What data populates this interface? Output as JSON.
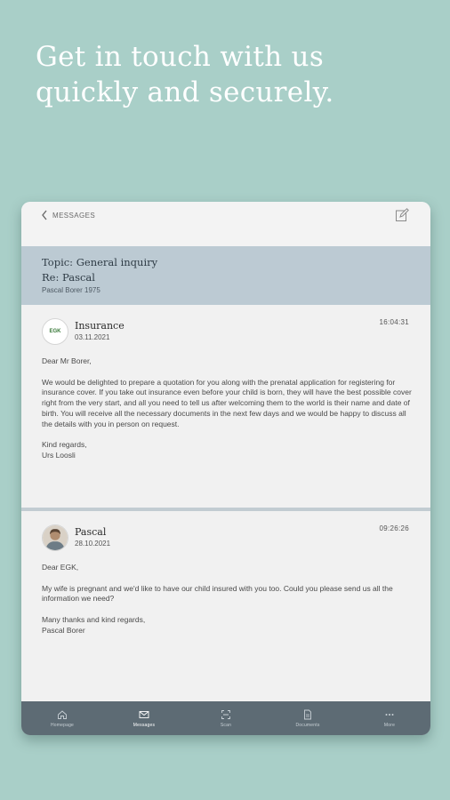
{
  "headline": {
    "line1": "Get in touch with us",
    "line2": "quickly and securely."
  },
  "colors": {
    "background": "#a9cfc8",
    "topic_band": "#bccad3",
    "tabbar": "#5d6b74"
  },
  "topbar": {
    "back_label": "MESSAGES",
    "back_icon": "chevron-left-icon",
    "compose_icon": "compose-icon"
  },
  "topic": {
    "title": "Topic: General inquiry",
    "subtitle": "Re: Pascal",
    "reference": "Pascal Borer 1975"
  },
  "messages": [
    {
      "sender": "Insurance",
      "date": "03.11.2021",
      "time": "16:04:31",
      "avatar": "EGK",
      "greeting": "Dear Mr Borer,",
      "body": "We would be delighted to prepare a quotation for you along with the prenatal application for registering for insurance cover. If you take out insurance even before your child is born, they will have the best possible cover right from the very start, and all you need to tell us after welcoming them to the world is their name and date of birth. You will receive all the necessary documents in the next few days and we would be happy to discuss all the details with you in person on request.",
      "closing": "Kind regards,",
      "signature": "Urs Loosli"
    },
    {
      "sender": "Pascal",
      "date": "28.10.2021",
      "time": "09:26:26",
      "avatar": "person-avatar",
      "greeting": "Dear EGK,",
      "body": "My wife is pregnant and we'd like to have our child insured with you too. Could you please send us all the information we need?",
      "closing": "Many thanks and kind regards,",
      "signature": "Pascal Borer"
    }
  ],
  "tabbar": {
    "tabs": [
      {
        "label": "Homepage",
        "icon": "home-icon"
      },
      {
        "label": "Messages",
        "icon": "mail-icon",
        "active": true
      },
      {
        "label": "Scan",
        "icon": "scan-icon"
      },
      {
        "label": "Documents",
        "icon": "document-icon"
      },
      {
        "label": "More",
        "icon": "more-icon"
      }
    ]
  }
}
